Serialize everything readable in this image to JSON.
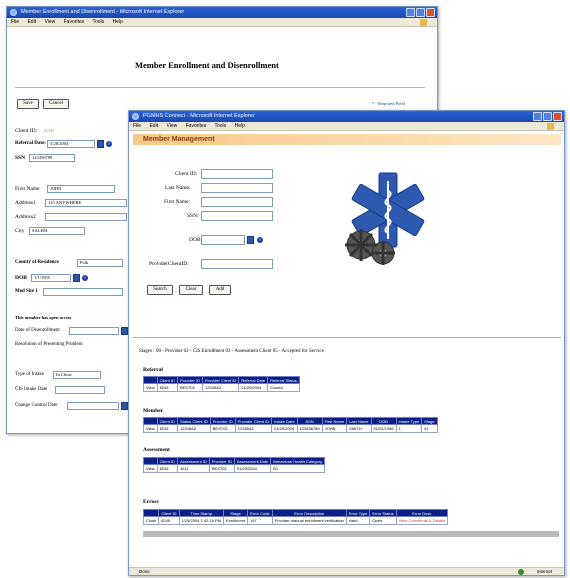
{
  "back_window": {
    "title": "Member Enrollment and Disenrollment - Microsoft Internet Explorer",
    "menu": [
      "File",
      "Edit",
      "View",
      "Favorites",
      "Tools",
      "Help"
    ],
    "heading": "Member Enrollment and Disenrollment",
    "save_label": "Save",
    "cancel_label": "Cancel",
    "required_note": "* - Required Field",
    "client_id_label": "Client ID:",
    "client_id_value": "12345",
    "referral_date_label": "Referral Date:",
    "referral_date_value": "3/28/2004",
    "ssn_label": "SSN",
    "ssn_value": "123456789",
    "first_name_label": "First Name",
    "first_name_value": "JOHN",
    "address1_label": "Address1",
    "address1_value": "123 ANYWHERE",
    "address2_label": "Address2",
    "city_label": "City",
    "city_value": "SALEM",
    "county_label": "County of Residence",
    "county_value": "Polk",
    "dob_label": "DOB",
    "dob_value": "1/1/1955",
    "medsite_label": "Med Site 1",
    "disenroll_note": "This member has open access",
    "disenroll_date_label": "Date of Disenrollment",
    "resolution_label": "Resolution of Presenting Problem",
    "intake_type_label": "Type of Intake",
    "intake_type_value": "In Clinic",
    "cis_intake_label": "CIS Intake Date",
    "change_control_label": "Change Control Date"
  },
  "front_window": {
    "title": "PGMHS Connect - Microsoft Internet Explorer",
    "menu": [
      "File",
      "Edit",
      "View",
      "Favorites",
      "Tools",
      "Help"
    ],
    "banner": "Member Management",
    "client_id_label": "Client ID:",
    "last_name_label": "Last Name:",
    "first_name_label": "First Name:",
    "ssn_label": "SSN:",
    "dob_label": "DOB:",
    "provider_client_id_label": "ProviderClientID:",
    "search_label": "Search",
    "clear_label": "Clear",
    "add_label": "Add",
    "stages_text": "Stages : 00 - Provider  02 - CIS Enrollment  03 - Assessment Client  05 - Accepted for Service",
    "status_text": "Done",
    "status_zone": "Internet",
    "referral": {
      "title": "Referral",
      "headers": [
        "",
        "Client ID",
        "Provider ID",
        "Provider Client ID",
        "Referral Date",
        "Referral Status"
      ],
      "rows": [
        [
          "View",
          "8245",
          "BEST02",
          "12345AZ",
          "01/20/2004",
          "Closed"
        ]
      ]
    },
    "member": {
      "title": "Member",
      "headers": [
        "",
        "Client ID",
        "Status Client ID",
        "Provider ID",
        "Provider Client ID",
        "Intake Date",
        "SSN",
        "First Name",
        "Last Name",
        "DOB",
        "Intake Type",
        "Stage"
      ],
      "rows": [
        [
          "View",
          "8245",
          "12345AZ",
          "BEST02",
          "12345AZ",
          "01/20/2004",
          "123456789",
          "JOHN",
          "SMITH",
          "01/01/1955",
          "1",
          "01"
        ]
      ]
    },
    "assessment": {
      "title": "Assessment",
      "headers": [
        "",
        "Client ID",
        "Assessment ID",
        "Provider ID",
        "Assessment Date",
        "Behavioral Health Category"
      ],
      "rows": [
        [
          "View",
          "8245",
          "1011",
          "BEST02",
          "01/20/2004",
          "B1"
        ]
      ]
    },
    "errors": {
      "title": "Errors",
      "headers": [
        "",
        "Client ID",
        "Time Stamp",
        "Stage",
        "Error Code",
        "Error Description",
        "Error Type",
        "Error Status",
        "Error Desc"
      ],
      "rows": [
        [
          "Close",
          "8245",
          "1/29/2004 1:42:16 PM",
          "Enrollment",
          "197",
          "Provider manual enrollment verification",
          "Hard",
          "Open",
          "View Comments & Details"
        ]
      ]
    }
  }
}
